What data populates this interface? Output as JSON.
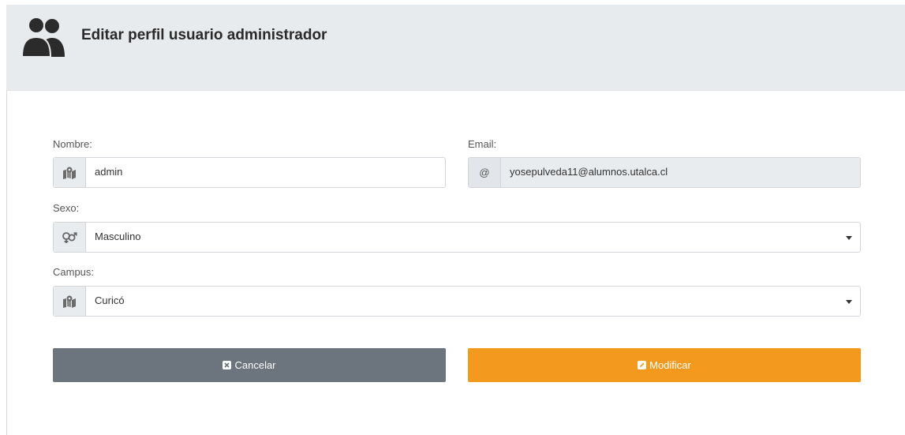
{
  "header": {
    "title": "Editar perfil usuario administrador",
    "icon": "users-icon"
  },
  "form": {
    "nombre": {
      "label": "Nombre:",
      "value": "admin",
      "icon": "map-icon"
    },
    "email": {
      "label": "Email:",
      "value": "yosepulveda11@alumnos.utalca.cl",
      "icon": "at-icon",
      "disabled": true
    },
    "sexo": {
      "label": "Sexo:",
      "value": "Masculino",
      "icon": "gender-icon"
    },
    "campus": {
      "label": "Campus:",
      "value": "Curicó",
      "icon": "map-icon"
    }
  },
  "buttons": {
    "cancel": {
      "label": "Cancelar",
      "icon": "close-square-icon",
      "color": "#6c757d"
    },
    "modify": {
      "label": "Modificar",
      "icon": "edit-square-icon",
      "color": "#f39a1e"
    }
  },
  "colors": {
    "header_bg": "#e8ebee",
    "addon_bg": "#e9ecef"
  }
}
